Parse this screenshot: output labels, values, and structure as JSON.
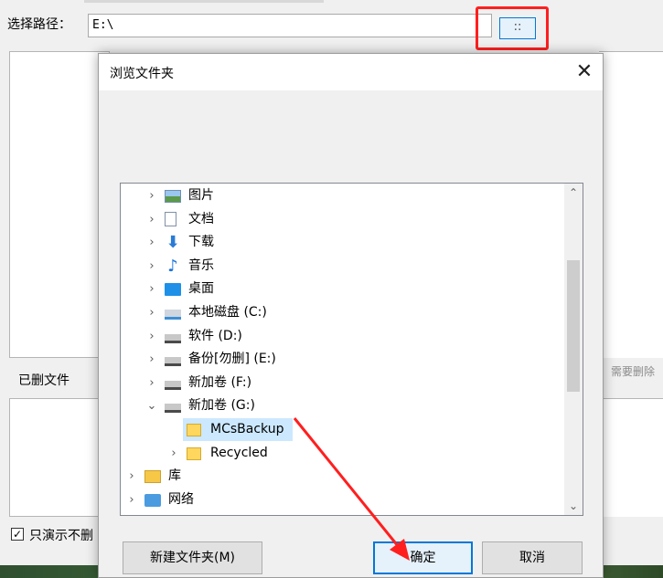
{
  "app": {
    "path_label": "选择路径：",
    "path_value": "E:\\",
    "browse_label": "::",
    "deleted_files_label": "已删文件",
    "need_delete_hint": "需要删除",
    "demo_checkbox_label": "只演示不删",
    "demo_checked": true
  },
  "dialog": {
    "title": "浏览文件夹",
    "close_label": "✕",
    "tree": [
      {
        "label": "图片",
        "icon": "pictures-icon",
        "level": 1,
        "expanded": false
      },
      {
        "label": "文档",
        "icon": "documents-icon",
        "level": 1,
        "expanded": false
      },
      {
        "label": "下载",
        "icon": "downloads-icon",
        "level": 1,
        "expanded": false
      },
      {
        "label": "音乐",
        "icon": "music-icon",
        "level": 1,
        "expanded": false
      },
      {
        "label": "桌面",
        "icon": "desktop-icon",
        "level": 1,
        "expanded": false
      },
      {
        "label": "本地磁盘 (C:)",
        "icon": "os-drive-icon",
        "level": 1,
        "expanded": false
      },
      {
        "label": "软件 (D:)",
        "icon": "drive-icon",
        "level": 1,
        "expanded": false
      },
      {
        "label": "备份[勿删] (E:)",
        "icon": "drive-icon",
        "level": 1,
        "expanded": false
      },
      {
        "label": "新加卷 (F:)",
        "icon": "drive-icon",
        "level": 1,
        "expanded": false
      },
      {
        "label": "新加卷 (G:)",
        "icon": "drive-icon",
        "level": 1,
        "expanded": true
      },
      {
        "label": "MCsBackup",
        "icon": "folder-icon",
        "level": 2,
        "selected": true
      },
      {
        "label": "Recycled",
        "icon": "folder-icon",
        "level": 2,
        "expanded": false
      },
      {
        "label": "库",
        "icon": "library-icon",
        "level": 0,
        "expanded": false
      },
      {
        "label": "网络",
        "icon": "network-icon",
        "level": 0,
        "expanded": false
      }
    ],
    "new_folder_label": "新建文件夹(M)",
    "ok_label": "确定",
    "cancel_label": "取消"
  },
  "colors": {
    "highlight_red": "#ff1f1f",
    "selection": "#cce8ff",
    "accent": "#0078d7"
  }
}
